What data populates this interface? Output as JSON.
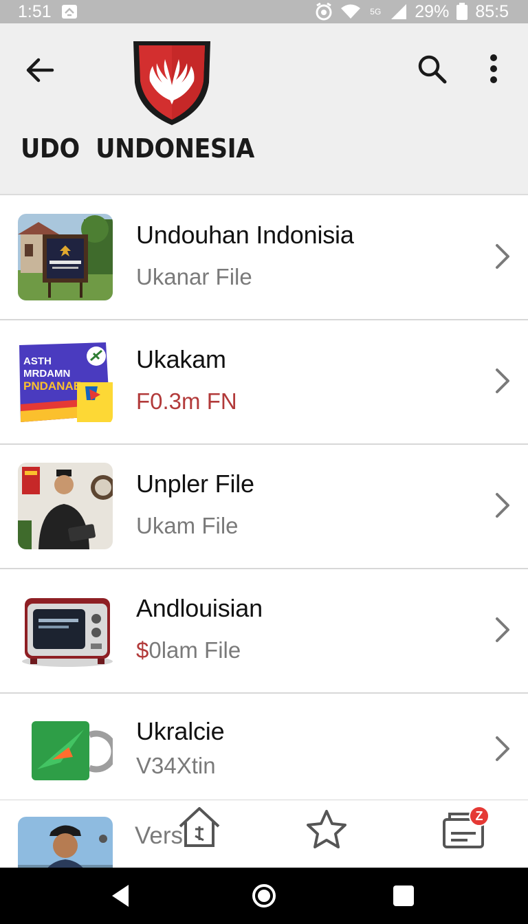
{
  "status_bar": {
    "time": "1:51",
    "network_label": "5G",
    "battery_percent": "29%",
    "right_value": "85:5",
    "icons": [
      "notification-icon",
      "alarm-icon",
      "wifi-icon",
      "signal-icon",
      "battery-icon"
    ]
  },
  "app_bar": {
    "title": "UDO  UNDONESIA",
    "icons": [
      "back-arrow-icon",
      "shield-logo",
      "search-icon",
      "more-vert-icon"
    ],
    "accent_color": "#d32f2f"
  },
  "list": {
    "items": [
      {
        "title": "Undouhan Indonisia",
        "subtitle_plain": "Ukanar File",
        "subtitle_red": "",
        "thumb": "building-sign-photo"
      },
      {
        "title": "Ukakam",
        "subtitle_plain": "",
        "subtitle_red": "F0.3m FN",
        "thumb": "software-box-photo",
        "box_line1": "ASTH",
        "box_line2": "MRDAMN",
        "box_line3": "PNDANAE"
      },
      {
        "title": "Unpler File",
        "subtitle_plain": "Ukam File",
        "subtitle_red": "",
        "thumb": "man-with-tablet-photo"
      },
      {
        "title": "Andlouisian",
        "subtitle_red": "$",
        "subtitle_plain": "0lam File",
        "thumb": "retro-tv-photo"
      },
      {
        "title": "Ukralcie",
        "subtitle_plain": "V34Xtin",
        "subtitle_red": "",
        "thumb": "green-app-icon"
      }
    ],
    "partial_item": {
      "text": "Versi",
      "thumb": "man-portrait-photo"
    }
  },
  "bottom_nav": {
    "icons": [
      "home-icon",
      "star-icon",
      "inbox-icon"
    ],
    "badge_text": "Z"
  },
  "system_nav": {
    "icons": [
      "nav-back-icon",
      "nav-home-icon",
      "nav-recents-icon"
    ]
  }
}
